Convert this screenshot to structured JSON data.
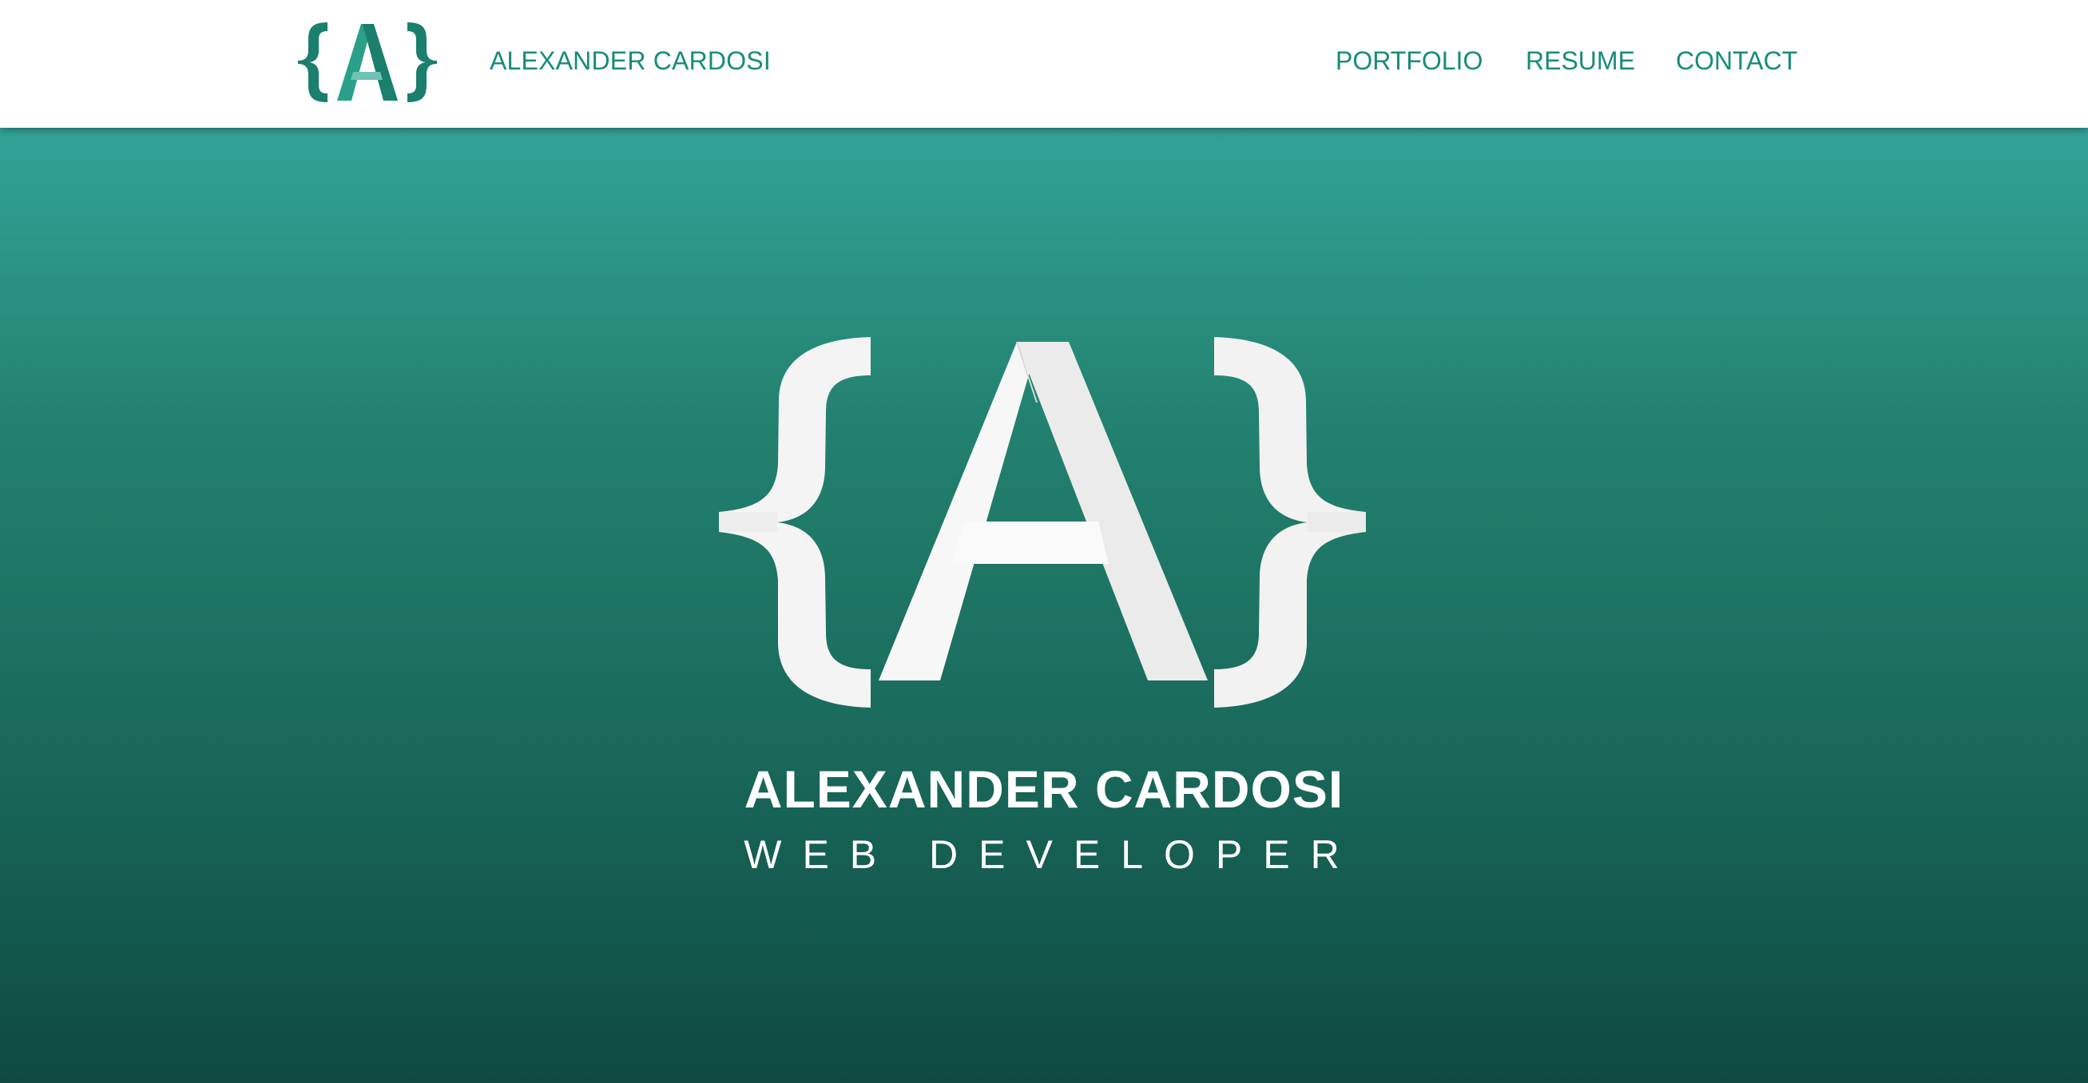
{
  "nav": {
    "brand_name": "ALEXANDER CARDOSI",
    "links": [
      {
        "label": "PORTFOLIO"
      },
      {
        "label": "RESUME"
      },
      {
        "label": "CONTACT"
      }
    ]
  },
  "hero": {
    "name": "ALEXANDER CARDOSI",
    "role": "WEB DEVELOPER"
  },
  "colors": {
    "brand_teal": "#178c79",
    "hero_top": "#33a399",
    "hero_bottom": "#0e4a40",
    "logo_light": "#f3f3f3"
  },
  "icons": {
    "nav_logo": "curly-brace-a-logo",
    "hero_logo": "curly-brace-a-logo"
  }
}
